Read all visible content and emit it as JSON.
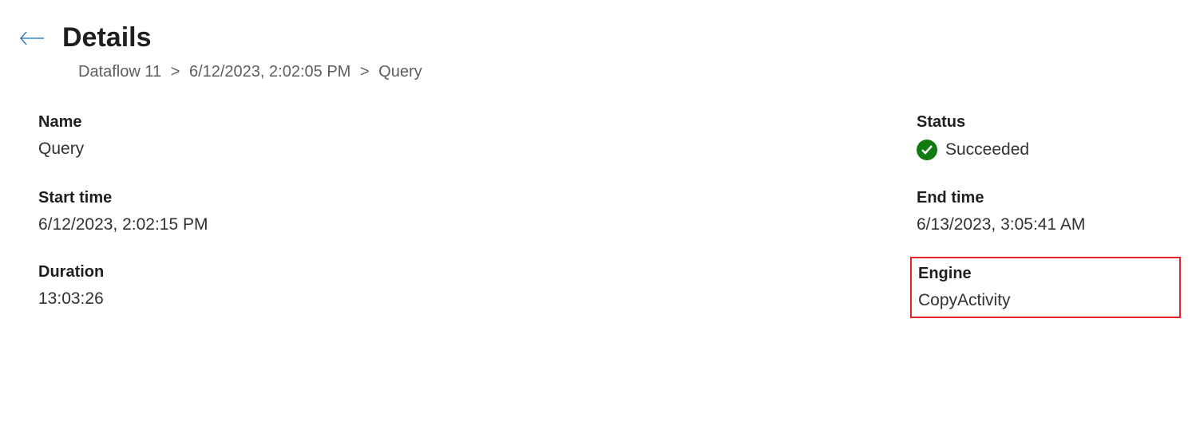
{
  "header": {
    "title": "Details"
  },
  "breadcrumb": {
    "items": [
      "Dataflow 11",
      "6/12/2023, 2:02:05 PM",
      "Query"
    ]
  },
  "fields": {
    "name": {
      "label": "Name",
      "value": "Query"
    },
    "status": {
      "label": "Status",
      "value": "Succeeded"
    },
    "start_time": {
      "label": "Start time",
      "value": "6/12/2023, 2:02:15 PM"
    },
    "end_time": {
      "label": "End time",
      "value": "6/13/2023, 3:05:41 AM"
    },
    "duration": {
      "label": "Duration",
      "value": "13:03:26"
    },
    "engine": {
      "label": "Engine",
      "value": "CopyActivity"
    }
  }
}
